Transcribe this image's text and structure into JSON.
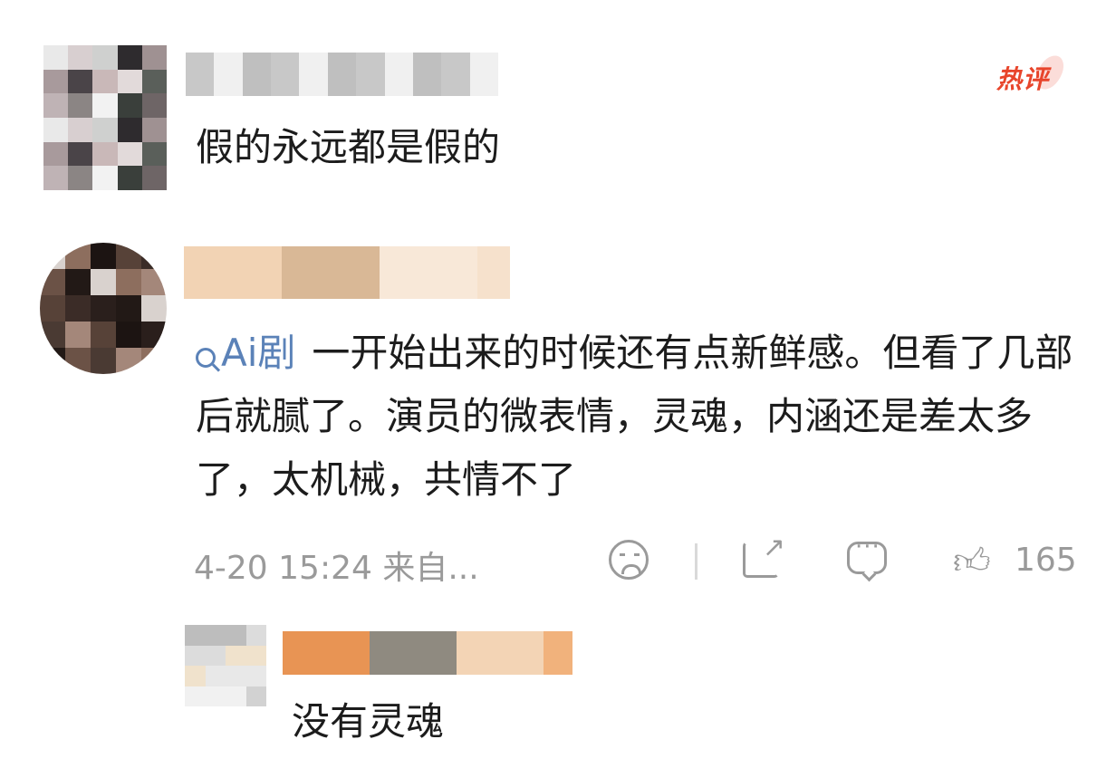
{
  "comments": [
    {
      "badge": "热评",
      "text": "假的永远都是假的"
    },
    {
      "tag": "Ai剧",
      "text": "一开始出来的时候还有点新鲜感。但看了几部后就腻了。演员的微表情，灵魂，内涵还是差太多了，太机械，共情不了",
      "time": "4-20 15:24",
      "source": "来自...",
      "likes": "165",
      "reply": {
        "text": "没有灵魂"
      }
    }
  ],
  "icons": {
    "sad": "sad-face-icon",
    "share": "share-icon",
    "comment": "comment-icon",
    "like": "thumbs-up-icon",
    "search": "search-icon"
  },
  "colors": {
    "badge": "#e8452b",
    "tag": "#5b82b8",
    "meta": "#9a9a9a"
  }
}
